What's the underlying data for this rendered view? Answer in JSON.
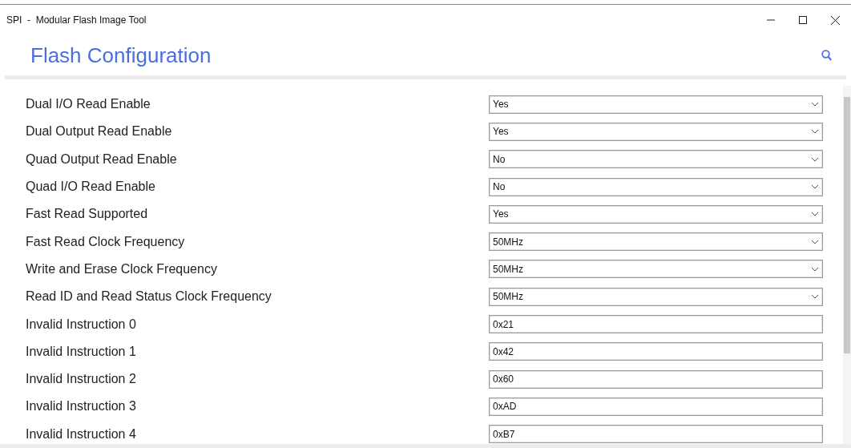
{
  "window": {
    "title": "SPI  -  Modular Flash Image Tool"
  },
  "header": {
    "title": "Flash Configuration"
  },
  "settings": [
    {
      "label": "Dual I/O Read Enable",
      "kind": "select",
      "value": "Yes"
    },
    {
      "label": "Dual Output Read Enable",
      "kind": "select",
      "value": "Yes"
    },
    {
      "label": "Quad Output Read Enable",
      "kind": "select",
      "value": "No"
    },
    {
      "label": "Quad I/O Read Enable",
      "kind": "select",
      "value": "No"
    },
    {
      "label": "Fast Read Supported",
      "kind": "select",
      "value": "Yes"
    },
    {
      "label": "Fast Read Clock Frequency",
      "kind": "select",
      "value": "50MHz"
    },
    {
      "label": "Write and Erase Clock Frequency",
      "kind": "select",
      "value": "50MHz"
    },
    {
      "label": "Read ID and Read Status Clock Frequency",
      "kind": "select",
      "value": "50MHz"
    },
    {
      "label": "Invalid Instruction 0",
      "kind": "text",
      "value": "0x21"
    },
    {
      "label": "Invalid Instruction 1",
      "kind": "text",
      "value": "0x42"
    },
    {
      "label": "Invalid Instruction 2",
      "kind": "text",
      "value": "0x60"
    },
    {
      "label": "Invalid Instruction 3",
      "kind": "text",
      "value": "0xAD"
    },
    {
      "label": "Invalid Instruction 4",
      "kind": "text",
      "value": "0xB7"
    }
  ]
}
